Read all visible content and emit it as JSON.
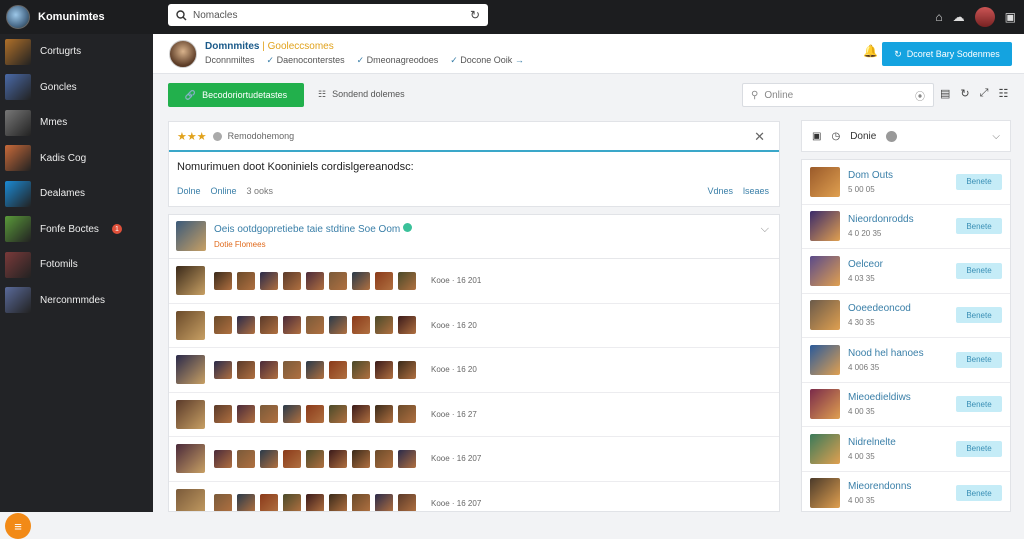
{
  "app": {
    "name": "Komunimtes"
  },
  "search": {
    "value": "Nomacles"
  },
  "sidebar": {
    "items": [
      {
        "label": "Cortugrts",
        "color": "#b0702a"
      },
      {
        "label": "Goncles",
        "color": "#4a6aa8"
      },
      {
        "label": "Mmes",
        "color": "#777"
      },
      {
        "label": "Kadis Cog",
        "color": "#c86a3a"
      },
      {
        "label": "Dealames",
        "color": "#1b8ad4"
      },
      {
        "label": "Fonfe Boctes",
        "badge": "1",
        "color": "#5a9a3a"
      },
      {
        "label": "Fotomils",
        "color": "#7a3a3a"
      },
      {
        "label": "Nerconmmdes",
        "color": "#5a6a9a"
      }
    ]
  },
  "header": {
    "title": "Domnmites",
    "title_extra": "| Gooleccsomes",
    "tabs": [
      "Dconnmiltes",
      "Daenoconterstes",
      "Dmeonagreodoes",
      "Docone Ooik"
    ],
    "primary_button": "Dcoret Bary Sodenmes"
  },
  "toolbar": {
    "green_button": "Becodoriortudetastes",
    "link": "Sondend dolemes",
    "filter_placeholder": "Online"
  },
  "post": {
    "rating_text": "Remodohemong",
    "body": "Nomurimuen doot Kooniniels cordislgereanodsc:",
    "meta_left": [
      "Dolne",
      "Online",
      "3 ooks"
    ],
    "meta_right": [
      "Vdnes",
      "lseaes"
    ]
  },
  "feed": {
    "title": "Oeis ootdgopretiebe taie stdtine Soe Oom",
    "subtitle": "Dotie Flomees",
    "rows": [
      {
        "meta": "Kooe · 16 201"
      },
      {
        "meta": "Kooe · 16 20"
      },
      {
        "meta": "Kooe · 16 20"
      },
      {
        "meta": "Kooe · 16 27"
      },
      {
        "meta": "Kooe · 16 207"
      },
      {
        "meta": "Kooe · 16 207"
      }
    ]
  },
  "right": {
    "head_label": "Donie",
    "items": [
      {
        "title": "Dom Outs",
        "sub": "5 00 05",
        "button": "Benete",
        "color": "#9a5a2a"
      },
      {
        "title": "Nieordonrodds",
        "sub": "4 0 20 35",
        "button": "Benete",
        "color": "#3a2a6a"
      },
      {
        "title": "Oelceor",
        "sub": "4 03 35",
        "button": "Benete",
        "color": "#5a4a8a"
      },
      {
        "title": "Ooeedeoncod",
        "sub": "4 30 35",
        "button": "Benete",
        "color": "#6a5a4a"
      },
      {
        "title": "Nood hel hanoes",
        "sub": "4 006 35",
        "button": "Benete",
        "color": "#2a5a9a"
      },
      {
        "title": "Mieoedieldiws",
        "sub": "4 00 35",
        "button": "Benete",
        "color": "#7a2a4a"
      },
      {
        "title": "Nidrelnelte",
        "sub": "4 00 35",
        "button": "Benete",
        "color": "#3a7a5a"
      },
      {
        "title": "Mieorendonns",
        "sub": "4 00 35",
        "button": "Benete",
        "color": "#4a3a2a"
      }
    ]
  }
}
